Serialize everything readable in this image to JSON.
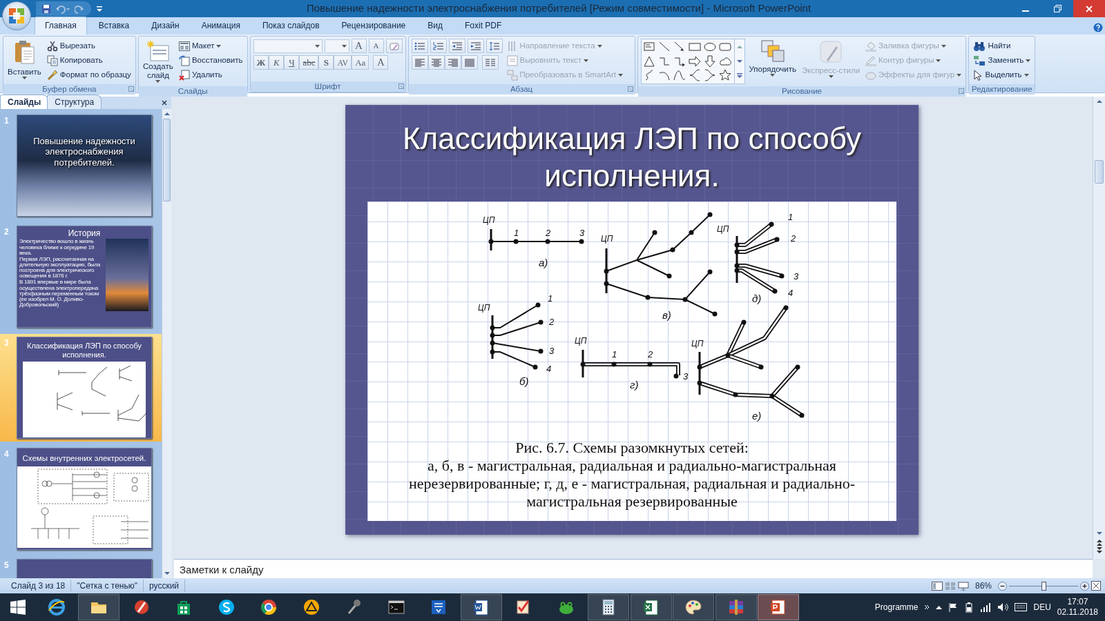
{
  "window": {
    "title": "Повышение надежности электроснабжения потребителей [Режим совместимости] - Microsoft PowerPoint"
  },
  "ribbon_tabs": [
    {
      "label": "Главная",
      "selected": true
    },
    {
      "label": "Вставка",
      "selected": false
    },
    {
      "label": "Дизайн",
      "selected": false
    },
    {
      "label": "Анимация",
      "selected": false
    },
    {
      "label": "Показ слайдов",
      "selected": false
    },
    {
      "label": "Рецензирование",
      "selected": false
    },
    {
      "label": "Вид",
      "selected": false
    },
    {
      "label": "Foxit PDF",
      "selected": false
    }
  ],
  "ribbon_groups": [
    {
      "kind": "commands",
      "title": "Буфер обмена",
      "large": [
        {
          "label": "Вставить",
          "dropdown": true,
          "disabled": false
        }
      ],
      "small": [
        {
          "label": "Вырезать",
          "dropdown": false,
          "disabled": false
        },
        {
          "label": "Копировать",
          "dropdown": false,
          "disabled": false
        },
        {
          "label": "Формат по образцу",
          "dropdown": false,
          "disabled": false
        }
      ]
    },
    {
      "kind": "commands",
      "title": "Слайды",
      "large": [
        {
          "label": "Создать слайд",
          "dropdown": true,
          "disabled": false
        }
      ],
      "small": [
        {
          "label": "Макет",
          "dropdown": true,
          "disabled": false
        },
        {
          "label": "Восстановить",
          "dropdown": false,
          "disabled": false
        },
        {
          "label": "Удалить",
          "dropdown": false,
          "disabled": false
        }
      ]
    },
    {
      "kind": "font",
      "title": "Шрифт",
      "glyphs_top": [
        "A",
        "A"
      ],
      "glyphs_bottom": [
        "Ж",
        "К",
        "Ч",
        "abc",
        "S",
        "AV",
        "Aa",
        "A"
      ]
    },
    {
      "kind": "paragraph",
      "title": "Абзац",
      "small": [
        {
          "label": "Направление текста",
          "dropdown": true,
          "disabled": true
        },
        {
          "label": "Выровнять текст",
          "dropdown": true,
          "disabled": true
        },
        {
          "label": "Преобразовать в SmartArt",
          "dropdown": true,
          "disabled": true
        }
      ]
    },
    {
      "kind": "drawing",
      "title": "Рисование",
      "large": [
        {
          "label": "Упорядочить",
          "dropdown": true,
          "disabled": false
        },
        {
          "label": "Экспресс-стили",
          "dropdown": true,
          "disabled": true
        }
      ],
      "small": [
        {
          "label": "Заливка фигуры",
          "dropdown": true,
          "disabled": true
        },
        {
          "label": "Контур фигуры",
          "dropdown": true,
          "disabled": true
        },
        {
          "label": "Эффекты для фигур",
          "dropdown": true,
          "disabled": true
        }
      ]
    },
    {
      "kind": "commands",
      "title": "Редактирование",
      "small": [
        {
          "label": "Найти",
          "dropdown": false,
          "disabled": false
        },
        {
          "label": "Заменить",
          "dropdown": true,
          "disabled": false
        },
        {
          "label": "Выделить",
          "dropdown": true,
          "disabled": false
        }
      ]
    }
  ],
  "panel_tabs": [
    {
      "label": "Слайды",
      "selected": true
    },
    {
      "label": "Структура",
      "selected": false
    }
  ],
  "slides": [
    {
      "number": "1",
      "kind": "title-photo",
      "title": "Повышение  надежности электроснабжения потребителей.",
      "selected": false
    },
    {
      "number": "2",
      "kind": "bullets-photo",
      "title": "История",
      "bullets": [
        "Электричество вошло в жизнь человека ближе к середине 19 века.",
        "Первая ЛЭП, рассчитанная на длительную эксплуатацию, была построена для электрического освещения в 1876 г.",
        "В 1891 впервые в мире была осуществлена электропередача трёхфазным переменным током  (ее изобрел М. О. Доливо-Добровольский)"
      ],
      "selected": false
    },
    {
      "number": "3",
      "kind": "figure",
      "title": "Классификация ЛЭП по способу исполнения.",
      "selected": true
    },
    {
      "number": "4",
      "kind": "schematic",
      "title": "Схемы внутренних электросетей.",
      "selected": false
    },
    {
      "number": "5",
      "kind": "cut",
      "selected": false
    }
  ],
  "slide": {
    "title": "Классификация ЛЭП по способу исполнения.",
    "figure": {
      "schemes": [
        {
          "label": "а)",
          "source": "ЦП",
          "nodes": [
            "1",
            "2",
            "3"
          ]
        },
        {
          "label": "в)",
          "source": "ЦП"
        },
        {
          "label": "д)",
          "source": "ЦП",
          "nodes": [
            "1",
            "2",
            "3",
            "4"
          ]
        },
        {
          "label": "б)",
          "source": "ЦП",
          "nodes": [
            "1",
            "2",
            "3",
            "4"
          ]
        },
        {
          "label": "г)",
          "source": "ЦП",
          "nodes": [
            "1",
            "2",
            "3"
          ]
        },
        {
          "label": "е)",
          "source": "ЦП"
        }
      ],
      "caption": [
        "Рис. 6.7. Схемы разомкнутых сетей:",
        "а, б, в - магистральная, радиальная и радиально-магистральная",
        "нерезервированные; г, д, е - магистральная, радиальная и радиально-",
        "магистральная резервированные"
      ]
    }
  },
  "notes": {
    "text": "Заметки к слайду"
  },
  "status_bar": {
    "slide": "Слайд 3 из 18",
    "theme": "\"Сетка с тенью\"",
    "language": "русский",
    "zoom": {
      "label": "86%",
      "level": 0.5
    }
  },
  "taskbar": {
    "apps": [
      {
        "running": false,
        "selected": false
      },
      {
        "running": true,
        "selected": false
      },
      {
        "running": false,
        "selected": false
      },
      {
        "running": false,
        "selected": false
      },
      {
        "running": false,
        "selected": false
      },
      {
        "running": false,
        "selected": false
      },
      {
        "running": false,
        "selected": false
      },
      {
        "running": false,
        "selected": false
      },
      {
        "running": false,
        "selected": false
      },
      {
        "running": false,
        "selected": false
      },
      {
        "running": true,
        "selected": false
      },
      {
        "running": false,
        "selected": false
      },
      {
        "running": false,
        "selected": false
      },
      {
        "running": true,
        "selected": false
      },
      {
        "running": true,
        "selected": false
      },
      {
        "running": true,
        "selected": false
      },
      {
        "running": true,
        "selected": false
      },
      {
        "running": true,
        "selected": true
      }
    ],
    "toolbar_label": "Programme",
    "language": "DEU",
    "time": "17:07",
    "date": "02.11.2018"
  }
}
